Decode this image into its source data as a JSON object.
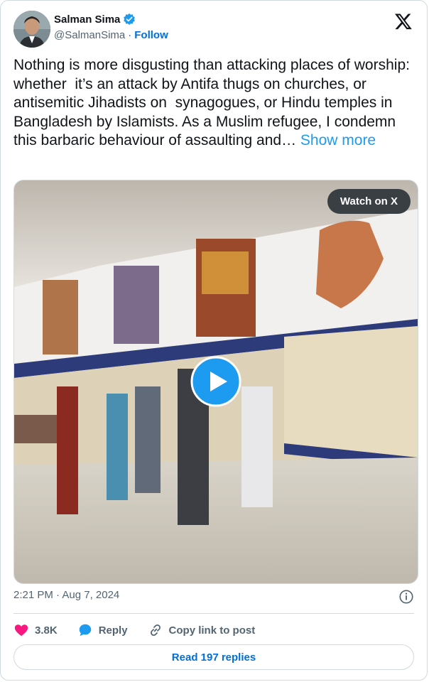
{
  "author": {
    "name": "Salman Sima",
    "handle": "@SalmanSima",
    "separator": "·",
    "follow_label": "Follow"
  },
  "tweet": {
    "text": "Nothing is more disgusting than attacking places of worship: whether  it’s an attack by Antifa thugs on churches, or antisemitic Jihadists on  synagogues, or Hindu temples in Bangladesh by Islamists. As a Muslim refugee, I condemn this barbaric behaviour of assaulting and… ",
    "show_more_label": "Show more"
  },
  "media": {
    "watch_label": "Watch on X"
  },
  "meta": {
    "timestamp": "2:21 PM · Aug 7, 2024"
  },
  "actions": {
    "likes_count": "3.8K",
    "reply_label": "Reply",
    "copy_label": "Copy link to post"
  },
  "read_replies_label": "Read 197 replies",
  "colors": {
    "link": "#1d9bf0",
    "like": "#f91880",
    "verified": "#1d9bf0"
  }
}
